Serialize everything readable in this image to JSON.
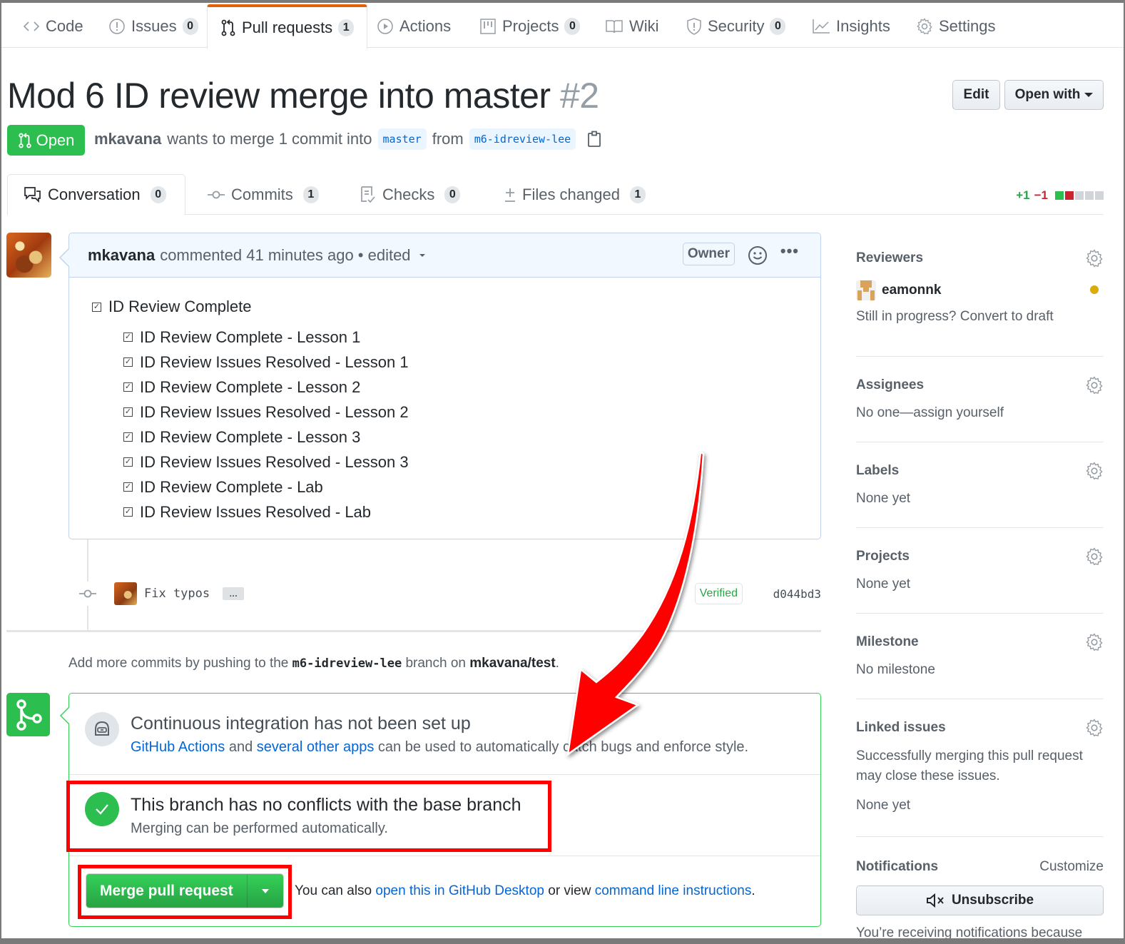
{
  "repo_nav": {
    "tabs": [
      {
        "label": "Code",
        "icon": "code-icon",
        "count": null
      },
      {
        "label": "Issues",
        "icon": "issue-icon",
        "count": "0"
      },
      {
        "label": "Pull requests",
        "icon": "pull-request-icon",
        "count": "1",
        "selected": true
      },
      {
        "label": "Actions",
        "icon": "play-icon",
        "count": null
      },
      {
        "label": "Projects",
        "icon": "project-icon",
        "count": "0"
      },
      {
        "label": "Wiki",
        "icon": "book-icon",
        "count": null
      },
      {
        "label": "Security",
        "icon": "shield-icon",
        "count": "0"
      },
      {
        "label": "Insights",
        "icon": "graph-icon",
        "count": null
      },
      {
        "label": "Settings",
        "icon": "gear-icon",
        "count": null
      }
    ]
  },
  "header": {
    "title": "Mod 6 ID review merge into master",
    "number": "#2",
    "edit_label": "Edit",
    "open_with_label": "Open with",
    "state_label": "Open",
    "author": "mkavana",
    "merge_text": "wants to merge 1 commit into",
    "base_branch": "master",
    "from_text": "from",
    "head_branch": "m6-idreview-lee",
    "copy_icon": "clipboard-icon"
  },
  "pr_tabs": [
    {
      "label": "Conversation",
      "count": "0",
      "icon": "comment-discussion-icon",
      "selected": true
    },
    {
      "label": "Commits",
      "count": "1",
      "icon": "commit-icon"
    },
    {
      "label": "Checks",
      "count": "0",
      "icon": "checklist-icon"
    },
    {
      "label": "Files changed",
      "count": "1",
      "icon": "diff-icon"
    }
  ],
  "diffstat": {
    "additions": "+1",
    "deletions": "−1",
    "blocks": [
      "#2cbe4e",
      "#cb2431",
      "#d1d5da",
      "#d1d5da",
      "#d1d5da"
    ]
  },
  "comment": {
    "author": "mkavana",
    "meta": "commented 41 minutes ago • edited",
    "role_badge": "Owner",
    "top_task": "ID Review Complete",
    "tasks": [
      "ID Review Complete - Lesson 1",
      "ID Review Issues Resolved - Lesson 1",
      "ID Review Complete - Lesson 2",
      "ID Review Issues Resolved - Lesson 2",
      "ID Review Complete - Lesson 3",
      "ID Review Issues Resolved - Lesson 3",
      "ID Review Complete - Lab",
      "ID Review Issues Resolved - Lab"
    ]
  },
  "commit": {
    "message": "Fix typos",
    "ellipsis": "…",
    "verified_label": "Verified",
    "sha": "d044bd3"
  },
  "push_note": {
    "prefix": "Add more commits by pushing to the",
    "branch": "m6-idreview-lee",
    "middle": "branch on",
    "repo": "mkavana/test",
    "suffix": "."
  },
  "merge_box": {
    "ci_title": "Continuous integration has not been set up",
    "ci_link1": "GitHub Actions",
    "ci_and": "and",
    "ci_link2": "several other apps",
    "ci_rest": "can be used to automatically catch bugs and enforce style.",
    "ok_title": "This branch has no conflicts with the base branch",
    "ok_sub": "Merging can be performed automatically.",
    "merge_label": "Merge pull request",
    "also_prefix": "You can also",
    "also_link1": "open this in GitHub Desktop",
    "also_mid": "or view",
    "also_link2": "command line instructions",
    "also_suffix": "."
  },
  "sidebar": {
    "reviewers": {
      "title": "Reviewers",
      "reviewer": "eamonnk",
      "status_color": "#dbab09",
      "draft_note": "Still in progress? Convert to draft"
    },
    "assignees": {
      "title": "Assignees",
      "body": "No one—assign yourself"
    },
    "labels": {
      "title": "Labels",
      "body": "None yet"
    },
    "projects": {
      "title": "Projects",
      "body": "None yet"
    },
    "milestone": {
      "title": "Milestone",
      "body": "No milestone"
    },
    "linked_issues": {
      "title": "Linked issues",
      "desc": "Successfully merging this pull request may close these issues.",
      "body": "None yet"
    },
    "notifications": {
      "title": "Notifications",
      "customize": "Customize",
      "unsubscribe": "Unsubscribe",
      "note": "You’re receiving notifications because"
    }
  },
  "annotations": {
    "highlight_color": "#ff0000"
  }
}
